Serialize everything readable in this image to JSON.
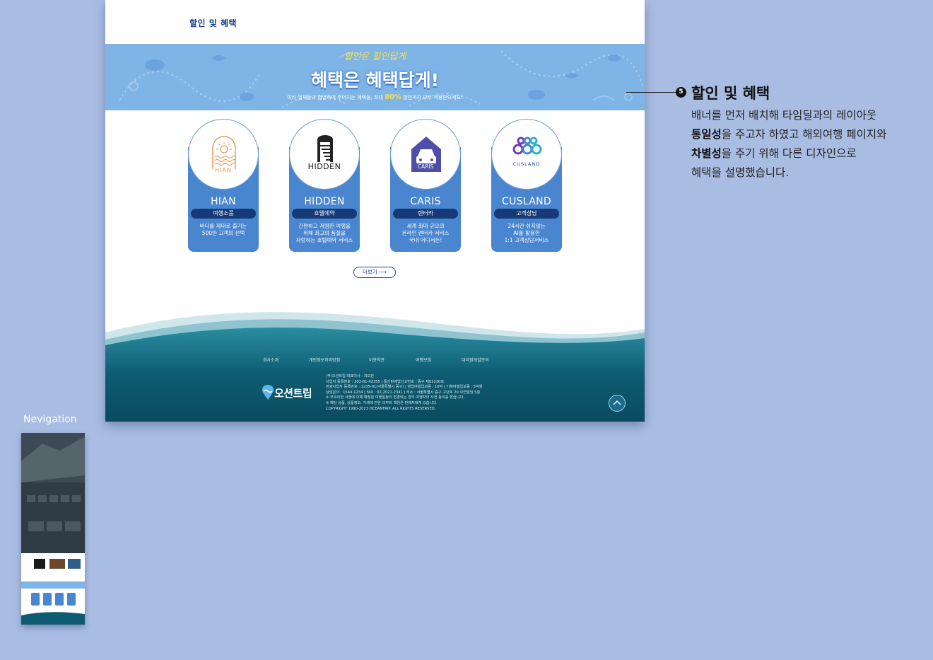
{
  "page": {
    "section_title": "할인 및 혜택"
  },
  "banner": {
    "script_text": "할인은 할인답게",
    "headline": "혜택은 혜택답게!",
    "desc_before": "여러 업체들과 협업하여 주어지는 혜택들, 최대 ",
    "desc_highlight": "80%",
    "desc_after": " 할인까지 모두 적용받으세요!"
  },
  "cards": [
    {
      "name": "HIAN",
      "logo_text": "HIAN",
      "category": "여행소품",
      "desc": [
        "바다를 제대로 즐기는",
        "500만 고객의 선택"
      ]
    },
    {
      "name": "HIDDEN",
      "logo_text": "HIDDEN",
      "category": "호텔예약",
      "desc": [
        "간편하고 저렴한 여행을",
        "위해 최고의 품질을",
        "자랑하는 호텔예약 서비스"
      ]
    },
    {
      "name": "CARIS",
      "logo_text": "CARIS",
      "category": "렌터카",
      "desc": [
        "세계 최대 규모의",
        "온라인 렌터카 서비스",
        "국내 어디서든!"
      ]
    },
    {
      "name": "CUSLAND",
      "logo_text": "CUSLAND",
      "category": "고객상담",
      "desc": [
        "24시간 쉬지않는",
        "AI를 활용한",
        "1:1 고객상담서비스"
      ]
    }
  ],
  "more_button": "더보기 ⟶",
  "footer": {
    "links": [
      "회사소개",
      "개인정보처리방침",
      "이용약관",
      "여행보험",
      "대리점개설문의"
    ],
    "logo_text": "오션트립",
    "info": [
      "(주)오션트립 대표이사 : 곽오관",
      "사업자 등록번호 : 202-81-42355 | 통신판매업신고번호 : 중구 제03230호",
      "관광사업자 등록번호 : 1235-01(서울특별시 중구) | 영업여행업보증 : 10억 | 기획여행업보증 : 5억원",
      "상담문의 : 1544-1234 | FAX : 02-2021-2341 | 주소 : 서울특별시 중구 구단로 20 이연빌딩 5층",
      "※ 부득이한 사정에 의해 확정된 여행일정이 변경되는 경우 여행자의 사전 동의를 받습니다.",
      "※ 해당 상품, 상품정보, 거래에 관한 의무와 책임은 판매자에게 있습니다.",
      "COPYRIGHT 1990-2023 OCEANTRIP. ALL RIGHTS RESERVED."
    ]
  },
  "annotation": {
    "number": "5",
    "title": "할인 및 혜택",
    "line1": "배너를 먼저 배치해 타임딜과의 레이아웃",
    "line2_bold": "통일성",
    "line2_rest": "을 주고자 하였고 해외여행 페이지와",
    "line3_bold": "차별성",
    "line3_rest": "을 주기 위해 다른 디자인으로",
    "line4": "혜택을 설명했습니다."
  },
  "navigation": {
    "label": "Nevigation"
  },
  "colors": {
    "background": "#a9bde3",
    "banner": "#7fb4e6",
    "card_blue": "#4a86cf",
    "pill_navy": "#153a77",
    "footer_teal": "#0e5c72",
    "highlight_yellow": "#f3e04f"
  }
}
